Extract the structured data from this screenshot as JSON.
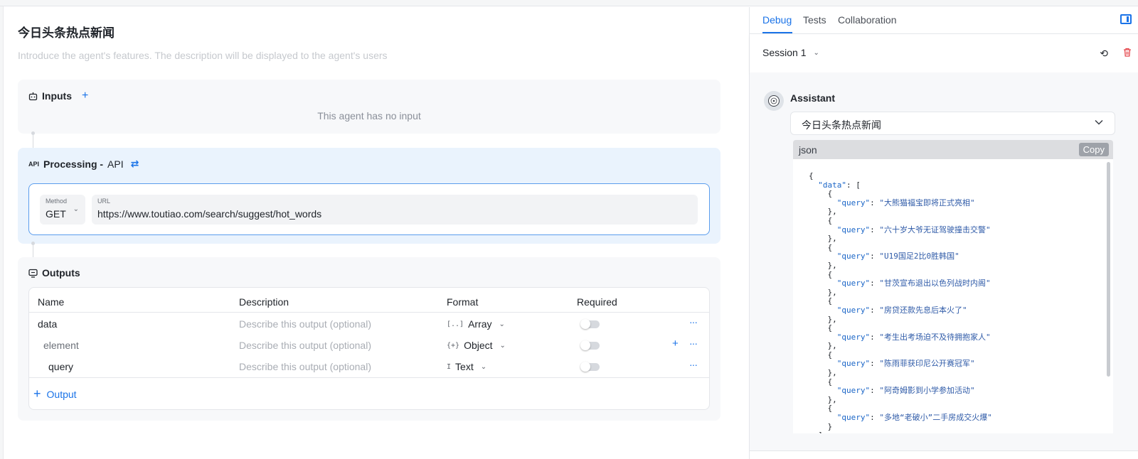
{
  "agent": {
    "title": "今日头条热点新闻",
    "description_placeholder": "Introduce the agent's features. The description will be displayed to the agent's users"
  },
  "inputs": {
    "label": "Inputs",
    "add_symbol": "+",
    "empty_text": "This agent has no input"
  },
  "processing": {
    "label": "Processing -",
    "type": "API",
    "api_tag": "API",
    "method_label": "Method",
    "method_value": "GET",
    "url_label": "URL",
    "url_value": "https://www.toutiao.com/search/suggest/hot_words"
  },
  "outputs": {
    "label": "Outputs",
    "columns": [
      "Name",
      "Description",
      "Format",
      "Required"
    ],
    "rows": [
      {
        "name": "data",
        "description": "Describe this output (optional)",
        "format": "Array",
        "format_icon": "[..]"
      },
      {
        "name": "element",
        "description": "Describe this output (optional)",
        "format": "Object",
        "format_icon": "{+}"
      },
      {
        "name": "query",
        "description": "Describe this output (optional)",
        "format": "Text",
        "format_icon": "I"
      }
    ],
    "add_label": "Output"
  },
  "debug": {
    "tabs": [
      "Debug",
      "Tests",
      "Collaboration"
    ],
    "active_tab": "Debug",
    "session_label": "Session 1",
    "assistant_name": "Assistant",
    "reply_title": "今日头条热点新闻",
    "code_lang": "json",
    "copy_label": "Copy",
    "queries": [
      "大熊猫福宝即将正式亮相",
      "六十岁大爷无证驾驶撞击交警",
      "U19国足2比0胜韩国",
      "甘茨宣布退出以色列战时内阁",
      "房贷还款先息后本火了",
      "考生出考场迫不及待拥抱家人",
      "陈雨菲获印尼公开赛冠军",
      "阿奇姆影到小学参加活动",
      "多地“老破小”二手房成交火爆"
    ]
  },
  "icons": {
    "inputs": "robot-icon",
    "outputs": "monitor-icon",
    "swap": "swap-icon",
    "panel": "sidebar-toggle-icon",
    "history": "history-icon",
    "trash": "trash-icon",
    "avatar": "assistant-avatar"
  },
  "colors": {
    "accent": "#1a73e8",
    "danger": "#e5484d",
    "processing_bg": "#eaf3fd"
  }
}
